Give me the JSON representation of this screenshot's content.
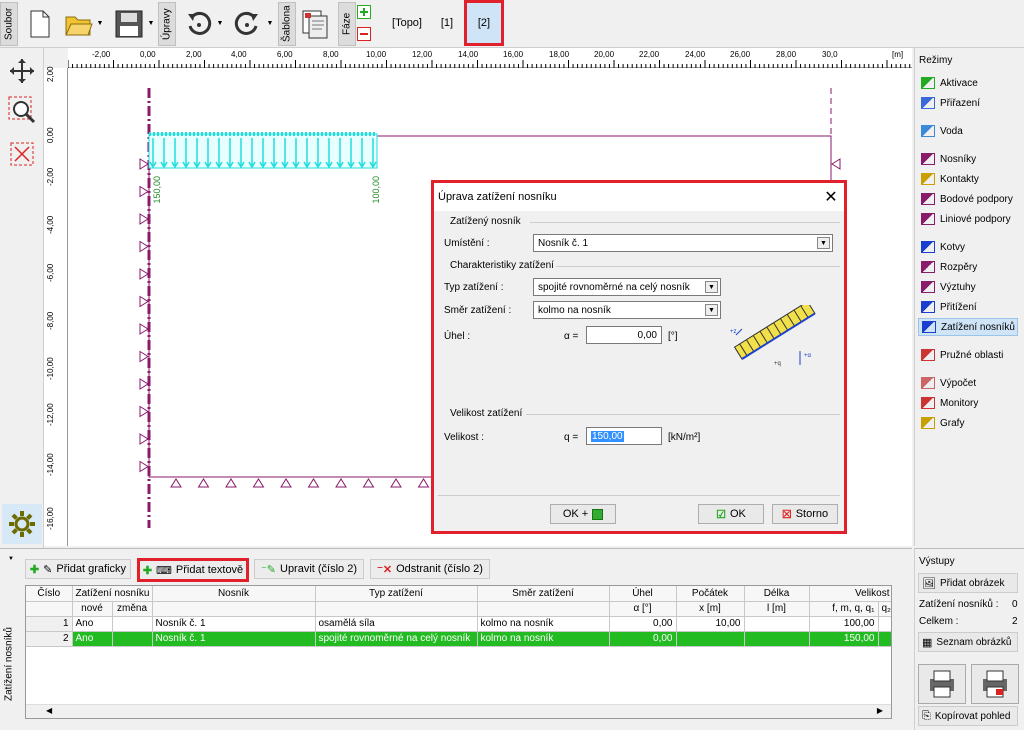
{
  "toolbar": {
    "soubor": "Soubor",
    "upravy": "Úpravy",
    "sablona": "Šablona",
    "faze": "Fáze",
    "stages": [
      "[Topo]",
      "[1]",
      "[2]"
    ]
  },
  "ruler": {
    "unit": "[m]",
    "x_labels": [
      "-2,00",
      "0,00",
      "2,00",
      "4,00",
      "6,00",
      "8,00",
      "10,00",
      "12,00",
      "14,00",
      "16,00",
      "18,00",
      "20,00",
      "22,00",
      "24,00",
      "26,00",
      "28,00",
      "30,0"
    ],
    "y_labels": [
      "2,00",
      "0,00",
      "-2,00",
      "-4,00",
      "-6,00",
      "-8,00",
      "-10,00",
      "-12,00",
      "-14,00",
      "-16,00"
    ]
  },
  "canvas": {
    "load_left": "150,00",
    "load_right": "100,00"
  },
  "modes": {
    "title": "Režimy",
    "items": [
      "Aktivace",
      "Přiřazení",
      "Voda",
      "Nosníky",
      "Kontakty",
      "Bodové podpory",
      "Liniové podpory",
      "Kotvy",
      "Rozpěry",
      "Výztuhy",
      "Přitížení",
      "Zatížení nosníků",
      "Pružné oblasti",
      "Výpočet",
      "Monitory",
      "Grafy"
    ],
    "active": "Zatížení nosníků"
  },
  "dialog": {
    "title": "Úprava zatížení nosníku",
    "group1": "Zatížený nosník",
    "umisteni_label": "Umístění :",
    "umisteni_value": "Nosník č. 1",
    "group2": "Charakteristiky zatížení",
    "typ_label": "Typ zatížení :",
    "typ_value": "spojité rovnoměrné na celý nosník",
    "smer_label": "Směr zatížení :",
    "smer_value": "kolmo na nosník",
    "uhel_label": "Úhel :",
    "alpha_label": "α =",
    "uhel_value": "0,00",
    "uhel_unit": "[°]",
    "group3": "Velikost zatížení",
    "velikost_label": "Velikost :",
    "q_label": "q =",
    "velikost_value": "150,00",
    "velikost_unit": "[kN/m²]",
    "ok_plus": "OK +",
    "ok": "OK",
    "storno": "Storno"
  },
  "bottom": {
    "side_label": "Zatížení nosníků",
    "buttons": {
      "graphic": "Přidat graficky",
      "text": "Přidat textově",
      "edit": "Upravit (číslo 2)",
      "remove": "Odstranit (číslo 2)"
    },
    "headers": {
      "cislo": "Číslo",
      "zat": "Zatížení nosníku",
      "nove": "nové",
      "zmena": "změna",
      "nosnik": "Nosník",
      "typ": "Typ zatížení",
      "smer": "Směr zatížení",
      "uhel": "Úhel",
      "uhel2": "α [°]",
      "pocatek": "Počátek",
      "pocatek2": "x [m]",
      "delka": "Délka",
      "delka2": "l [m]",
      "velikost": "Velikost",
      "velikost2": "f, m, q, q₁",
      "velikost3": "q₂"
    },
    "rows": [
      {
        "cislo": "1",
        "nove": "Ano",
        "zmena": "",
        "nosnik": "Nosník č. 1",
        "typ": "osamělá síla",
        "smer": "kolmo na nosník",
        "uhel": "0,00",
        "pocatek": "10,00",
        "delka": "",
        "velikost": "100,00"
      },
      {
        "cislo": "2",
        "nove": "Ano",
        "zmena": "",
        "nosnik": "Nosník č. 1",
        "typ": "spojité rovnoměrné na celý nosník",
        "smer": "kolmo na nosník",
        "uhel": "0,00",
        "pocatek": "",
        "delka": "",
        "velikost": "150,00"
      }
    ]
  },
  "outputs": {
    "title": "Výstupy",
    "add_image": "Přidat obrázek",
    "count_label": "Zatížení nosníků :",
    "count_value": "0",
    "total_label": "Celkem :",
    "total_value": "2",
    "list": "Seznam obrázků",
    "copy": "Kopírovat pohled"
  },
  "colors": {
    "accent_red": "#e0202a",
    "selection_green": "#22bb22",
    "load_cyan": "#22dddd",
    "beam_purple": "#8a1a6a"
  }
}
